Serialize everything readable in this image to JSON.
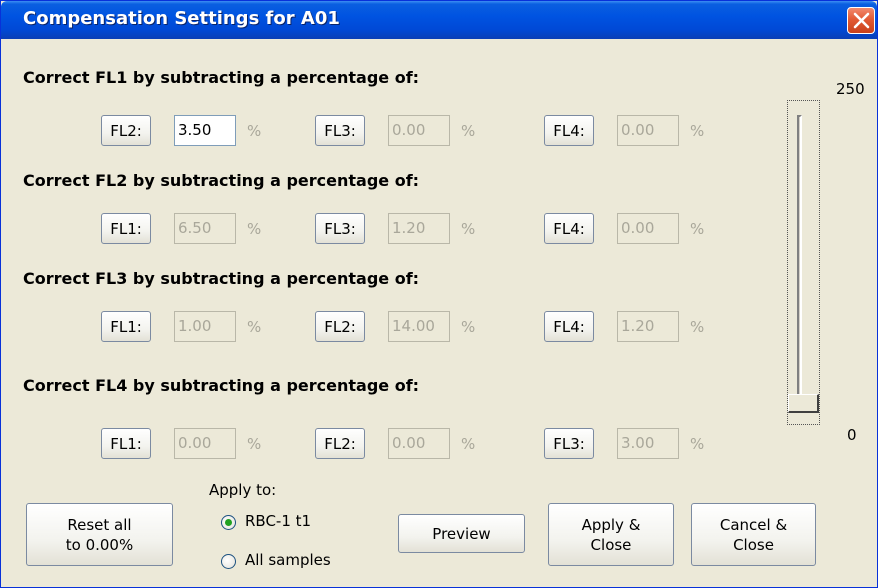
{
  "window": {
    "title": "Compensation Settings for A01",
    "close_icon": "close-icon"
  },
  "sections": [
    {
      "title": "Correct FL1 by subtracting a percentage of:",
      "fields": [
        {
          "button": "FL2:",
          "value": "3.50",
          "unit": "%",
          "enabled": true
        },
        {
          "button": "FL3:",
          "value": "0.00",
          "unit": "%",
          "enabled": false
        },
        {
          "button": "FL4:",
          "value": "0.00",
          "unit": "%",
          "enabled": false
        }
      ]
    },
    {
      "title": "Correct FL2 by subtracting a percentage of:",
      "fields": [
        {
          "button": "FL1:",
          "value": "6.50",
          "unit": "%",
          "enabled": false
        },
        {
          "button": "FL3:",
          "value": "1.20",
          "unit": "%",
          "enabled": false
        },
        {
          "button": "FL4:",
          "value": "0.00",
          "unit": "%",
          "enabled": false
        }
      ]
    },
    {
      "title": "Correct FL3 by subtracting a percentage of:",
      "fields": [
        {
          "button": "FL1:",
          "value": "1.00",
          "unit": "%",
          "enabled": false
        },
        {
          "button": "FL2:",
          "value": "14.00",
          "unit": "%",
          "enabled": false
        },
        {
          "button": "FL4:",
          "value": "1.20",
          "unit": "%",
          "enabled": false
        }
      ]
    },
    {
      "title": "Correct FL4 by subtracting a percentage of:",
      "fields": [
        {
          "button": "FL1:",
          "value": "0.00",
          "unit": "%",
          "enabled": false
        },
        {
          "button": "FL2:",
          "value": "0.00",
          "unit": "%",
          "enabled": false
        },
        {
          "button": "FL3:",
          "value": "3.00",
          "unit": "%",
          "enabled": false
        }
      ]
    }
  ],
  "slider": {
    "max_label": "250",
    "min_label": "0",
    "value_fraction": 0.0
  },
  "footer": {
    "reset_line1": "Reset all",
    "reset_line2": "to 0.00%",
    "apply_to_label": "Apply to:",
    "radio_options": [
      {
        "label": "RBC-1 t1",
        "selected": true
      },
      {
        "label": "All samples",
        "selected": false
      }
    ],
    "preview_label": "Preview",
    "apply_close_line1": "Apply &",
    "apply_close_line2": "Close",
    "cancel_close_line1": "Cancel &",
    "cancel_close_line2": "Close"
  },
  "colors": {
    "titlebar": "#0053e1",
    "dialog_bg": "#ece9d8",
    "disabled_text": "#a9a79a",
    "close_button": "#e25b35",
    "radio_dot": "#21a121"
  }
}
